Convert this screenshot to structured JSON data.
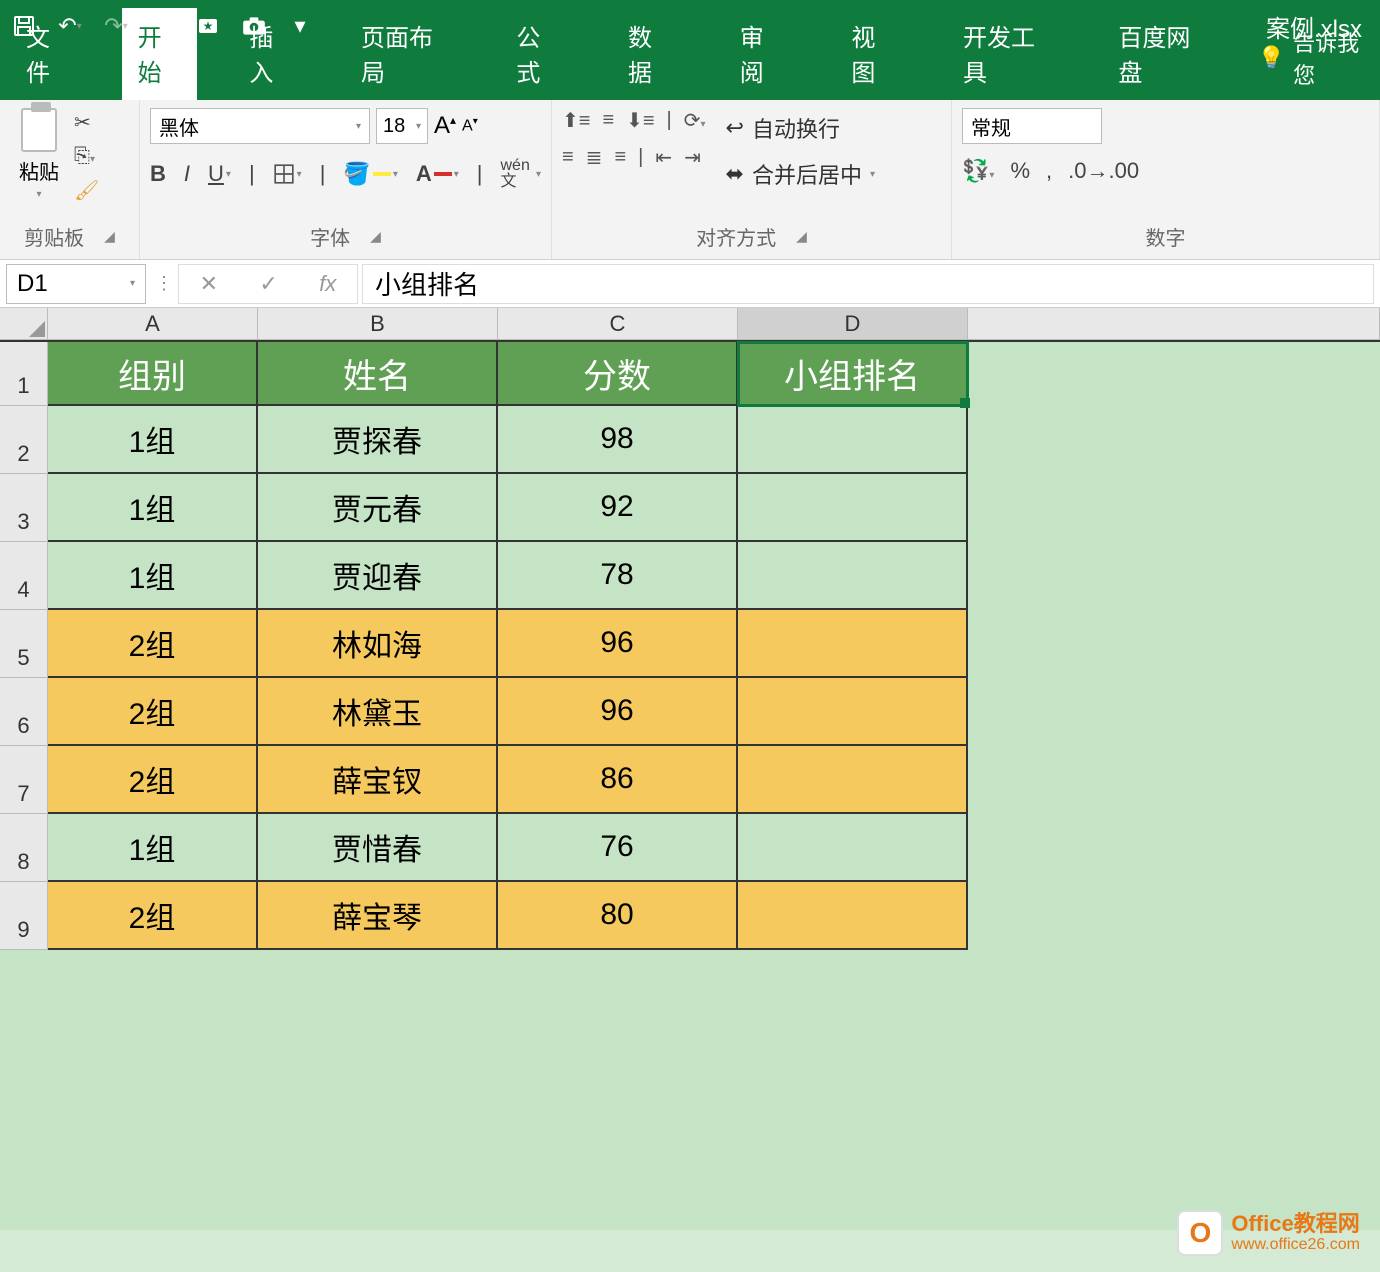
{
  "app": {
    "filename": "案例.xlsx"
  },
  "tabs": {
    "file": "文件",
    "home": "开始",
    "insert": "插入",
    "layout": "页面布局",
    "formulas": "公式",
    "data": "数据",
    "review": "审阅",
    "view": "视图",
    "dev": "开发工具",
    "baidu": "百度网盘",
    "tellme": "告诉我您"
  },
  "ribbon": {
    "clipboard": {
      "paste": "粘贴",
      "label": "剪贴板"
    },
    "font": {
      "name": "黑体",
      "size": "18",
      "bold": "B",
      "italic": "I",
      "underline": "U",
      "phonetic": "wén 文",
      "label": "字体"
    },
    "alignment": {
      "wrap": "自动换行",
      "merge": "合并后居中",
      "label": "对齐方式"
    },
    "number": {
      "format": "常规",
      "percent": "%",
      "comma": ",",
      "label": "数字"
    }
  },
  "namebox": "D1",
  "formula_value": "小组排名",
  "columns": [
    "A",
    "B",
    "C",
    "D"
  ],
  "header_row": [
    "组别",
    "姓名",
    "分数",
    "小组排名"
  ],
  "rows": [
    {
      "n": "2",
      "cls": "grn",
      "cells": [
        "1组",
        "贾探春",
        "98",
        ""
      ]
    },
    {
      "n": "3",
      "cls": "grn",
      "cells": [
        "1组",
        "贾元春",
        "92",
        ""
      ]
    },
    {
      "n": "4",
      "cls": "grn",
      "cells": [
        "1组",
        "贾迎春",
        "78",
        ""
      ]
    },
    {
      "n": "5",
      "cls": "yel",
      "cells": [
        "2组",
        "林如海",
        "96",
        ""
      ]
    },
    {
      "n": "6",
      "cls": "yel",
      "cells": [
        "2组",
        "林黛玉",
        "96",
        ""
      ]
    },
    {
      "n": "7",
      "cls": "yel",
      "cells": [
        "2组",
        "薛宝钗",
        "86",
        ""
      ]
    },
    {
      "n": "8",
      "cls": "grn",
      "cells": [
        "1组",
        "贾惜春",
        "76",
        ""
      ]
    },
    {
      "n": "9",
      "cls": "yel",
      "cells": [
        "2组",
        "薛宝琴",
        "80",
        ""
      ]
    }
  ],
  "watermark": {
    "title": "Office教程网",
    "url": "www.office26.com"
  },
  "chart_data": {
    "type": "table",
    "title": "案例.xlsx",
    "columns": [
      "组别",
      "姓名",
      "分数",
      "小组排名"
    ],
    "rows": [
      [
        "1组",
        "贾探春",
        98,
        null
      ],
      [
        "1组",
        "贾元春",
        92,
        null
      ],
      [
        "1组",
        "贾迎春",
        78,
        null
      ],
      [
        "2组",
        "林如海",
        96,
        null
      ],
      [
        "2组",
        "林黛玉",
        96,
        null
      ],
      [
        "2组",
        "薛宝钗",
        86,
        null
      ],
      [
        "1组",
        "贾惜春",
        76,
        null
      ],
      [
        "2组",
        "薛宝琴",
        80,
        null
      ]
    ]
  }
}
